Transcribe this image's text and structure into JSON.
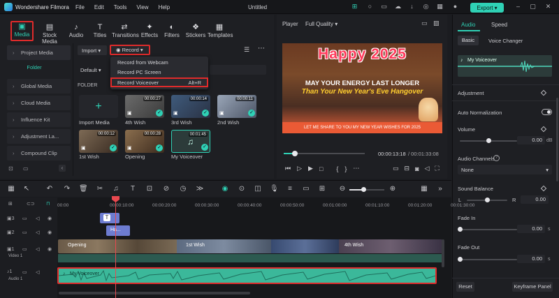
{
  "app": {
    "name": "Wondershare Filmora",
    "document": "Untitled",
    "export_label": "Export",
    "menu": [
      "File",
      "Edit",
      "Tools",
      "View",
      "Help"
    ]
  },
  "toolbar": {
    "items": [
      {
        "label": "Media",
        "icon": "media-icon"
      },
      {
        "label": "Stock Media",
        "icon": "stock-media-icon"
      },
      {
        "label": "Audio",
        "icon": "audio-icon"
      },
      {
        "label": "Titles",
        "icon": "titles-icon"
      },
      {
        "label": "Transitions",
        "icon": "transitions-icon"
      },
      {
        "label": "Effects",
        "icon": "effects-icon"
      },
      {
        "label": "Filters",
        "icon": "filters-icon"
      },
      {
        "label": "Stickers",
        "icon": "stickers-icon"
      },
      {
        "label": "Templates",
        "icon": "templates-icon"
      }
    ]
  },
  "sidebar": {
    "items": [
      "Project Media",
      "Folder",
      "Global Media",
      "Cloud Media",
      "Influence Kit",
      "Adjustment La...",
      "Compound Clip"
    ]
  },
  "media": {
    "import_label": "Import",
    "record_label": "Record",
    "default_label": "Default",
    "folder_label": "FOLDER",
    "record_menu": [
      {
        "label": "Record from Webcam",
        "shortcut": ""
      },
      {
        "label": "Record PC Screen",
        "shortcut": ""
      },
      {
        "label": "Record Voiceover",
        "shortcut": "Alt+R"
      }
    ],
    "items": [
      {
        "label": "Import Media",
        "duration": ""
      },
      {
        "label": "4th Wish",
        "duration": "00:00:27"
      },
      {
        "label": "3rd Wish",
        "duration": "00:00:14"
      },
      {
        "label": "2nd Wish",
        "duration": "00:00:11"
      },
      {
        "label": "1st Wish",
        "duration": "00:00:12"
      },
      {
        "label": "Opening",
        "duration": "00:00:28"
      },
      {
        "label": "My Voiceover",
        "duration": "00:01:45"
      }
    ]
  },
  "player": {
    "label": "Player",
    "quality": "Full Quality",
    "current_time": "00:00:13:18",
    "total_time": "/ 00:01:33:08",
    "progress": 0.14,
    "preview_text": {
      "title": "Happy 2025",
      "line1": "MAY YOUR ENERGY LAST LONGER",
      "line2": "Than Your New Year's Eve Hangover",
      "line3": "LET ME SHARE TO YOU MY NEW YEAR WISHES FOR 2025"
    }
  },
  "right_panel": {
    "tabs": [
      "Audio",
      "Speed"
    ],
    "subtabs": [
      "Basic",
      "Voice Changer"
    ],
    "clip_name": "My Voiceover",
    "section_adjustment": "Adjustment",
    "auto_normalization": "Auto Normalization",
    "volume": {
      "label": "Volume",
      "value": "0.00",
      "unit": "dB",
      "level": 0.5
    },
    "audio_channels": {
      "label": "Audio Channels",
      "value": "None"
    },
    "balance": {
      "label": "Sound Balance",
      "left": "L",
      "right": "R",
      "value": "0.00",
      "level": 0.5
    },
    "fade_in": {
      "label": "Fade In",
      "value": "0.00",
      "unit": "s",
      "level": 0.0
    },
    "fade_out": {
      "label": "Fade Out",
      "value": "0.00",
      "unit": "s",
      "level": 0.0
    },
    "reset_label": "Reset",
    "keyframe_label": "Keyframe Panel"
  },
  "timeline": {
    "ruler": [
      "00:00",
      "00:00:10:00",
      "00:00:20:00",
      "00:00:30:00",
      "00:00:40:00",
      "00:00:50:00",
      "00:01:00:00",
      "00:01:10:00",
      "00:01:20:00",
      "00:01:30:00"
    ],
    "tracks": [
      {
        "num": "3"
      },
      {
        "num": "2"
      },
      {
        "num": "1",
        "name": "Video 1"
      },
      {
        "num": "1",
        "name": "Audio 1"
      }
    ],
    "title_clip": "T",
    "hashtag_clip": "Ha...",
    "video_clips": [
      "Opening",
      "1st Wish",
      "4th Wish"
    ],
    "audio_clip": "My Voiceover"
  },
  "colors": {
    "accent": "#2fd1b5",
    "highlight": "#e02b2b",
    "audio_clip": "#3bb89a",
    "video_clip": "#3d5fb8"
  }
}
